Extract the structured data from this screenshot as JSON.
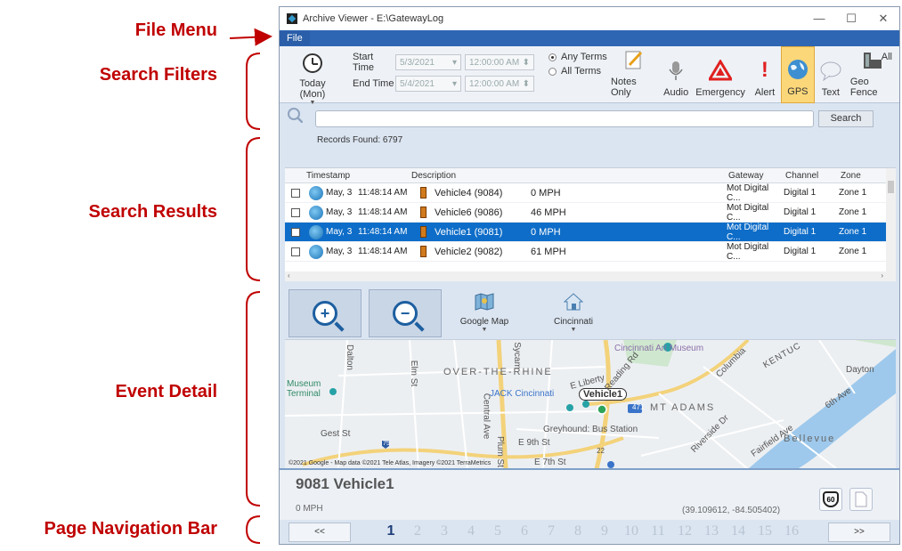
{
  "callouts": {
    "file_menu": "File Menu",
    "search_filters": "Search Filters",
    "search_results": "Search Results",
    "event_detail": "Event Detail",
    "page_nav": "Page Navigation Bar"
  },
  "window": {
    "title": "Archive Viewer - E:\\GatewayLog",
    "minimize": "—",
    "maximize": "☐",
    "close": "✕"
  },
  "menu": {
    "file": "File"
  },
  "filters": {
    "today_label": "Today (Mon)",
    "start_label": "Start Time",
    "end_label": "End Time",
    "start_date": "5/3/2021",
    "start_time": "12:00:00 AM",
    "end_date": "5/4/2021",
    "end_time": "12:00:00 AM",
    "any_terms": "Any Terms",
    "all_terms": "All Terms",
    "notes_only": "Notes Only",
    "audio": "Audio",
    "emergency": "Emergency",
    "alert": "Alert",
    "gps": "GPS",
    "text": "Text",
    "geo_fence": "Geo Fence",
    "all": "All",
    "selected_filter": "GPS"
  },
  "search": {
    "button": "Search",
    "records_found": "Records Found:  6797",
    "query": ""
  },
  "table": {
    "headers": {
      "timestamp": "Timestamp",
      "description": "Description",
      "gateway": "Gateway",
      "channel": "Channel",
      "zone": "Zone"
    },
    "rows": [
      {
        "date": "May, 3",
        "time": "11:48:14 AM",
        "vehicle": "Vehicle4 (9084)",
        "speed": "0 MPH",
        "gateway": "Mot Digital C...",
        "channel": "Digital 1",
        "zone": "Zone 1"
      },
      {
        "date": "May, 3",
        "time": "11:48:14 AM",
        "vehicle": "Vehicle6 (9086)",
        "speed": "46 MPH",
        "gateway": "Mot Digital C...",
        "channel": "Digital 1",
        "zone": "Zone 1"
      },
      {
        "date": "May, 3",
        "time": "11:48:14 AM",
        "vehicle": "Vehicle1 (9081)",
        "speed": "0 MPH",
        "gateway": "Mot Digital C...",
        "channel": "Digital 1",
        "zone": "Zone 1"
      },
      {
        "date": "May, 3",
        "time": "11:48:14 AM",
        "vehicle": "Vehicle2 (9082)",
        "speed": "61 MPH",
        "gateway": "Mot Digital C...",
        "channel": "Digital 1",
        "zone": "Zone 1"
      }
    ],
    "selected_row": 2
  },
  "map_toolbar": {
    "map_type": "Google Map",
    "location": "Cincinnati"
  },
  "map": {
    "labels": {
      "art_museum": "Cincinnati Art Museum",
      "otr": "OVER-THE-RHINE",
      "dayton": "Dayton",
      "museum": "Museum",
      "terminal": "Terminal",
      "jack": "JACK Cincinnati",
      "vehicle": "Vehicle1",
      "mt_adams": "MT ADAMS",
      "greyhound": "Greyhound: Bus Station",
      "bellevue": "Bellevue",
      "gest": "Gest St",
      "e9th": "E 9th St",
      "e7th": "E 7th St",
      "columbia": "Columbia",
      "riverside": "Riverside Dr",
      "central": "Central Ave",
      "sixth": "6th Ave",
      "fairfield": "Fairfield Ave",
      "kentucky": "KENTUC",
      "liberty": "E Liberty",
      "reading": "Reading Rd",
      "sycamore": "Sycam",
      "elm": "Elm St",
      "dalton": "Dalton",
      "plum": "Plum St",
      "i471": "471",
      "i75": "75",
      "us22": "22"
    },
    "attribution": "©2021 Google - Map data ©2021 Tele Atlas, Imagery ©2021 TerraMetrics"
  },
  "detail": {
    "title": "9081 Vehicle1",
    "speed": "0 MPH",
    "coords": "(39.109612, -84.505402)",
    "speed_sign": "60"
  },
  "pager": {
    "prev": "<<",
    "next": ">>",
    "pages": [
      "1",
      "2",
      "3",
      "4",
      "5",
      "6",
      "7",
      "8",
      "9",
      "10",
      "11",
      "12",
      "13",
      "14",
      "15",
      "16"
    ],
    "current": "1"
  },
  "colors": {
    "callout": "#c00000",
    "menubar": "#2f66b3",
    "selected_row": "#0e6dc8",
    "gps_active": "#fbd77a"
  }
}
